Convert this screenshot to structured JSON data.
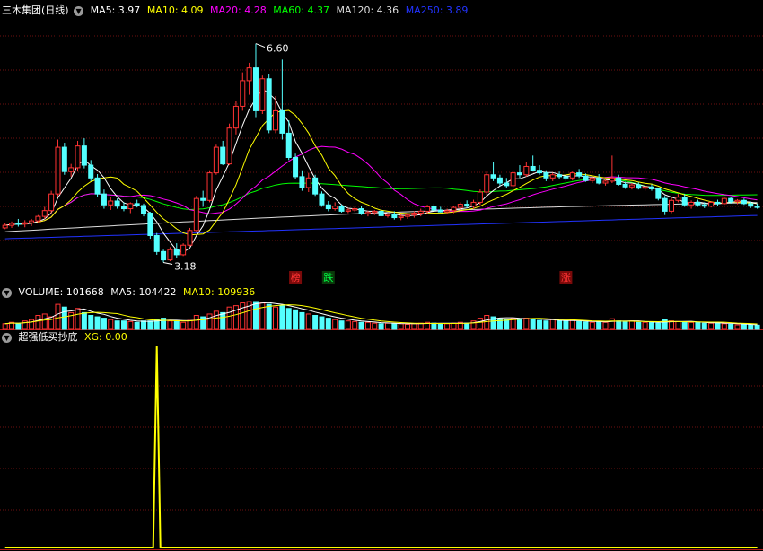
{
  "colors": {
    "up": "#ff3333",
    "down": "#54ffff",
    "ma5": "#ffffff",
    "ma10": "#ffff00",
    "ma20": "#ff00ff",
    "ma60": "#00ff00",
    "ma120": "#dddddd",
    "ma250": "#2233ff",
    "grid": "#6e1010",
    "panel_border": "#b01818",
    "xg": "#ffff00",
    "label": "#ffffff"
  },
  "price_panel": {
    "title": "三木集团(日线)",
    "indicators": [
      {
        "label": "MA5: 3.97",
        "color": "#ffffff"
      },
      {
        "label": "MA10: 4.09",
        "color": "#ffff00"
      },
      {
        "label": "MA20: 4.28",
        "color": "#ff00ff"
      },
      {
        "label": "MA60: 4.37",
        "color": "#00ff00"
      },
      {
        "label": "MA120: 4.36",
        "color": "#dddddd"
      },
      {
        "label": "MA250: 3.89",
        "color": "#2233ff"
      }
    ],
    "high_label": "6.60",
    "low_label": "3.18",
    "markers": [
      {
        "text": "榜",
        "color": "#ff3333",
        "bg": "#7a0a0a",
        "bar": 44
      },
      {
        "text": "跌",
        "color": "#00ff44",
        "bg": "#0a3a0a",
        "bar": 49
      },
      {
        "text": "涨",
        "color": "#ff3333",
        "bg": "#7a0a0a",
        "bar": 85
      }
    ]
  },
  "volume_panel": {
    "title": "VOLUME: 101668",
    "indicators": [
      {
        "label": "MA5: 104422",
        "color": "#ffffff"
      },
      {
        "label": "MA10: 109936",
        "color": "#ffff00"
      }
    ]
  },
  "xg_panel": {
    "title": "超强低买抄底",
    "indicators": [
      {
        "label": "XG: 0.00",
        "color": "#ffff00"
      }
    ]
  },
  "chart_data": {
    "type": "candlestick",
    "price_axis_range": [
      2.85,
      7.0
    ],
    "candles": [
      [
        3.72,
        3.8,
        3.7,
        3.76
      ],
      [
        3.76,
        3.82,
        3.72,
        3.79
      ],
      [
        3.79,
        3.86,
        3.74,
        3.78
      ],
      [
        3.78,
        3.84,
        3.73,
        3.8
      ],
      [
        3.8,
        3.86,
        3.75,
        3.83
      ],
      [
        3.83,
        3.92,
        3.8,
        3.9
      ],
      [
        3.9,
        4.05,
        3.86,
        3.99
      ],
      [
        3.99,
        4.3,
        3.95,
        4.25
      ],
      [
        4.25,
        5.1,
        4.2,
        4.98
      ],
      [
        4.98,
        5.05,
        4.55,
        4.6
      ],
      [
        4.6,
        4.72,
        4.52,
        4.66
      ],
      [
        4.66,
        5.08,
        4.6,
        5.0
      ],
      [
        5.0,
        5.12,
        4.65,
        4.7
      ],
      [
        4.7,
        4.78,
        4.45,
        4.5
      ],
      [
        4.5,
        4.56,
        4.2,
        4.25
      ],
      [
        4.25,
        4.32,
        4.02,
        4.08
      ],
      [
        4.08,
        4.2,
        4.0,
        4.14
      ],
      [
        4.14,
        4.18,
        4.02,
        4.06
      ],
      [
        4.06,
        4.12,
        3.98,
        4.02
      ],
      [
        4.02,
        4.12,
        3.95,
        4.1
      ],
      [
        4.1,
        4.16,
        4.04,
        4.07
      ],
      [
        4.07,
        4.1,
        3.9,
        3.95
      ],
      [
        3.95,
        3.97,
        3.55,
        3.6
      ],
      [
        3.6,
        3.64,
        3.3,
        3.35
      ],
      [
        3.35,
        3.38,
        3.18,
        3.22
      ],
      [
        3.22,
        3.42,
        3.2,
        3.38
      ],
      [
        3.38,
        3.48,
        3.25,
        3.3
      ],
      [
        3.3,
        3.48,
        3.28,
        3.45
      ],
      [
        3.45,
        3.72,
        3.43,
        3.68
      ],
      [
        3.68,
        4.22,
        3.65,
        4.18
      ],
      [
        4.18,
        4.3,
        4.05,
        4.15
      ],
      [
        4.15,
        4.62,
        4.12,
        4.58
      ],
      [
        4.58,
        5.02,
        4.55,
        4.98
      ],
      [
        4.98,
        5.08,
        4.7,
        4.72
      ],
      [
        4.72,
        5.35,
        4.7,
        5.28
      ],
      [
        5.28,
        5.7,
        5.18,
        5.62
      ],
      [
        5.62,
        6.15,
        5.55,
        6.02
      ],
      [
        6.02,
        6.3,
        5.8,
        6.22
      ],
      [
        6.22,
        6.6,
        5.45,
        5.55
      ],
      [
        5.55,
        6.1,
        5.5,
        6.05
      ],
      [
        6.05,
        6.12,
        5.2,
        5.25
      ],
      [
        5.25,
        5.78,
        5.2,
        5.55
      ],
      [
        5.55,
        6.35,
        5.1,
        5.2
      ],
      [
        5.2,
        5.4,
        4.78,
        4.82
      ],
      [
        4.82,
        4.88,
        4.48,
        4.52
      ],
      [
        4.52,
        4.62,
        4.3,
        4.35
      ],
      [
        4.35,
        4.58,
        4.28,
        4.5
      ],
      [
        4.5,
        4.55,
        4.22,
        4.25
      ],
      [
        4.25,
        4.29,
        4.05,
        4.08
      ],
      [
        4.08,
        4.14,
        3.98,
        4.02
      ],
      [
        4.02,
        4.12,
        3.99,
        4.06
      ],
      [
        4.06,
        4.09,
        3.96,
        3.98
      ],
      [
        3.98,
        4.03,
        3.95,
        4.0
      ],
      [
        4.0,
        4.05,
        3.97,
        4.02
      ],
      [
        4.02,
        4.06,
        3.92,
        3.94
      ],
      [
        3.94,
        3.99,
        3.9,
        3.96
      ],
      [
        3.96,
        4.0,
        3.92,
        3.98
      ],
      [
        3.98,
        4.01,
        3.9,
        3.91
      ],
      [
        3.91,
        3.95,
        3.88,
        3.93
      ],
      [
        3.93,
        3.98,
        3.85,
        3.88
      ],
      [
        3.88,
        3.93,
        3.84,
        3.9
      ],
      [
        3.9,
        3.95,
        3.86,
        3.92
      ],
      [
        3.92,
        3.98,
        3.88,
        3.95
      ],
      [
        3.95,
        4.02,
        3.9,
        3.98
      ],
      [
        3.98,
        4.08,
        3.94,
        4.05
      ],
      [
        4.05,
        4.1,
        3.98,
        4.0
      ],
      [
        4.0,
        4.05,
        3.96,
        3.97
      ],
      [
        3.97,
        4.02,
        3.93,
        3.99
      ],
      [
        3.99,
        4.06,
        3.95,
        4.04
      ],
      [
        4.04,
        4.12,
        4.0,
        4.09
      ],
      [
        4.09,
        4.15,
        4.03,
        4.06
      ],
      [
        4.06,
        4.16,
        4.02,
        4.12
      ],
      [
        4.12,
        4.32,
        4.08,
        4.28
      ],
      [
        4.28,
        4.6,
        4.22,
        4.55
      ],
      [
        4.55,
        4.75,
        4.45,
        4.5
      ],
      [
        4.5,
        4.55,
        4.38,
        4.42
      ],
      [
        4.42,
        4.5,
        4.35,
        4.38
      ],
      [
        4.38,
        4.62,
        4.35,
        4.58
      ],
      [
        4.58,
        4.7,
        4.5,
        4.55
      ],
      [
        4.55,
        4.75,
        4.52,
        4.68
      ],
      [
        4.68,
        4.85,
        4.6,
        4.62
      ],
      [
        4.62,
        4.7,
        4.55,
        4.58
      ],
      [
        4.58,
        4.62,
        4.45,
        4.5
      ],
      [
        4.5,
        4.58,
        4.45,
        4.55
      ],
      [
        4.55,
        4.6,
        4.48,
        4.52
      ],
      [
        4.52,
        4.56,
        4.45,
        4.5
      ],
      [
        4.5,
        4.6,
        4.46,
        4.58
      ],
      [
        4.58,
        4.64,
        4.5,
        4.53
      ],
      [
        4.53,
        4.57,
        4.44,
        4.46
      ],
      [
        4.46,
        4.52,
        4.42,
        4.5
      ],
      [
        4.5,
        4.56,
        4.4,
        4.42
      ],
      [
        4.42,
        4.48,
        4.38,
        4.45
      ],
      [
        4.45,
        4.85,
        4.42,
        4.5
      ],
      [
        4.5,
        4.55,
        4.38,
        4.4
      ],
      [
        4.4,
        4.44,
        4.33,
        4.36
      ],
      [
        4.36,
        4.42,
        4.32,
        4.39
      ],
      [
        4.39,
        4.43,
        4.32,
        4.34
      ],
      [
        4.34,
        4.38,
        4.3,
        4.36
      ],
      [
        4.36,
        4.4,
        4.3,
        4.33
      ],
      [
        4.33,
        4.35,
        4.15,
        4.18
      ],
      [
        4.18,
        4.22,
        3.92,
        3.98
      ],
      [
        3.98,
        4.2,
        3.95,
        4.15
      ],
      [
        4.15,
        4.25,
        4.12,
        4.2
      ],
      [
        4.2,
        4.25,
        4.05,
        4.08
      ],
      [
        4.08,
        4.15,
        4.02,
        4.12
      ],
      [
        4.12,
        4.16,
        4.05,
        4.08
      ],
      [
        4.08,
        4.12,
        4.03,
        4.06
      ],
      [
        4.06,
        4.14,
        4.04,
        4.12
      ],
      [
        4.12,
        4.16,
        4.06,
        4.1
      ],
      [
        4.1,
        4.2,
        4.08,
        4.18
      ],
      [
        4.18,
        4.21,
        4.1,
        4.13
      ],
      [
        4.13,
        4.17,
        4.09,
        4.15
      ],
      [
        4.15,
        4.18,
        4.08,
        4.1
      ],
      [
        4.1,
        4.13,
        4.03,
        4.06
      ],
      [
        4.06,
        4.1,
        4.02,
        4.04
      ]
    ],
    "volumes": [
      0.2,
      0.25,
      0.2,
      0.3,
      0.35,
      0.5,
      0.55,
      0.45,
      0.9,
      0.8,
      0.6,
      0.75,
      0.6,
      0.5,
      0.45,
      0.4,
      0.35,
      0.3,
      0.3,
      0.28,
      0.25,
      0.3,
      0.3,
      0.35,
      0.4,
      0.3,
      0.28,
      0.25,
      0.32,
      0.5,
      0.45,
      0.55,
      0.65,
      0.6,
      0.8,
      0.85,
      0.95,
      1.0,
      1.0,
      0.95,
      0.9,
      0.8,
      0.85,
      0.75,
      0.7,
      0.6,
      0.55,
      0.5,
      0.45,
      0.4,
      0.35,
      0.3,
      0.3,
      0.28,
      0.25,
      0.25,
      0.22,
      0.2,
      0.22,
      0.2,
      0.2,
      0.18,
      0.2,
      0.22,
      0.25,
      0.22,
      0.2,
      0.2,
      0.22,
      0.25,
      0.22,
      0.3,
      0.4,
      0.5,
      0.45,
      0.38,
      0.35,
      0.4,
      0.38,
      0.4,
      0.35,
      0.32,
      0.3,
      0.35,
      0.3,
      0.3,
      0.32,
      0.28,
      0.26,
      0.25,
      0.28,
      0.25,
      0.38,
      0.3,
      0.28,
      0.3,
      0.25,
      0.25,
      0.24,
      0.22,
      0.35,
      0.3,
      0.28,
      0.25,
      0.25,
      0.24,
      0.22,
      0.22,
      0.24,
      0.2,
      0.18,
      0.16,
      0.18,
      0.16,
      0.15
    ],
    "xg_values": [
      0,
      0,
      0,
      0,
      0,
      0,
      0,
      0,
      0,
      0,
      0,
      0,
      0,
      0,
      0,
      0,
      0,
      0,
      0,
      0,
      0,
      0,
      0,
      1,
      0,
      0,
      0,
      0,
      0,
      0,
      0,
      0,
      0,
      0,
      0,
      0,
      0,
      0,
      0,
      0,
      0,
      0,
      0,
      0,
      0,
      0,
      0,
      0,
      0,
      0,
      0,
      0,
      0,
      0,
      0,
      0,
      0,
      0,
      0,
      0,
      0,
      0,
      0,
      0,
      0,
      0,
      0,
      0,
      0,
      0,
      0,
      0,
      0,
      0,
      0,
      0,
      0,
      0,
      0,
      0,
      0,
      0,
      0,
      0,
      0,
      0,
      0,
      0,
      0,
      0,
      0,
      0,
      0,
      0,
      0,
      0,
      0,
      0,
      0,
      0,
      0,
      0,
      0,
      0,
      0,
      0,
      0,
      0,
      0,
      0,
      0,
      0,
      0,
      0,
      0
    ]
  }
}
